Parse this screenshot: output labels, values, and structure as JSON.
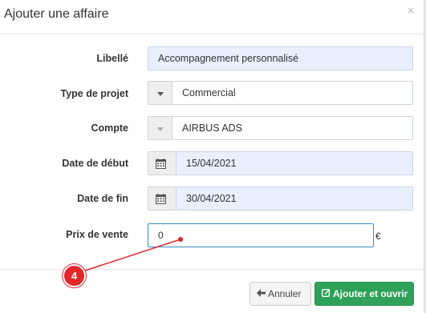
{
  "modal": {
    "title": "Ajouter une affaire",
    "close_glyph": "×"
  },
  "form": {
    "libelle": {
      "label": "Libellé",
      "value": "Accompagnement personnalisé"
    },
    "type_projet": {
      "label": "Type de projet",
      "value": "Commercial"
    },
    "compte": {
      "label": "Compte",
      "value": "AIRBUS ADS"
    },
    "date_debut": {
      "label": "Date de début",
      "value": "15/04/2021"
    },
    "date_fin": {
      "label": "Date de fin",
      "value": "30/04/2021"
    },
    "prix_vente": {
      "label": "Prix de vente",
      "value": "0",
      "currency": "€"
    }
  },
  "footer": {
    "cancel_label": "Annuler",
    "submit_label": "Ajouter et ouvrir"
  },
  "annotation": {
    "step": "4",
    "color": "#e2262a"
  },
  "colors": {
    "accent_green": "#2fa158",
    "field_blue": "#e8f0fe",
    "focus_border": "#3b8bc2"
  }
}
